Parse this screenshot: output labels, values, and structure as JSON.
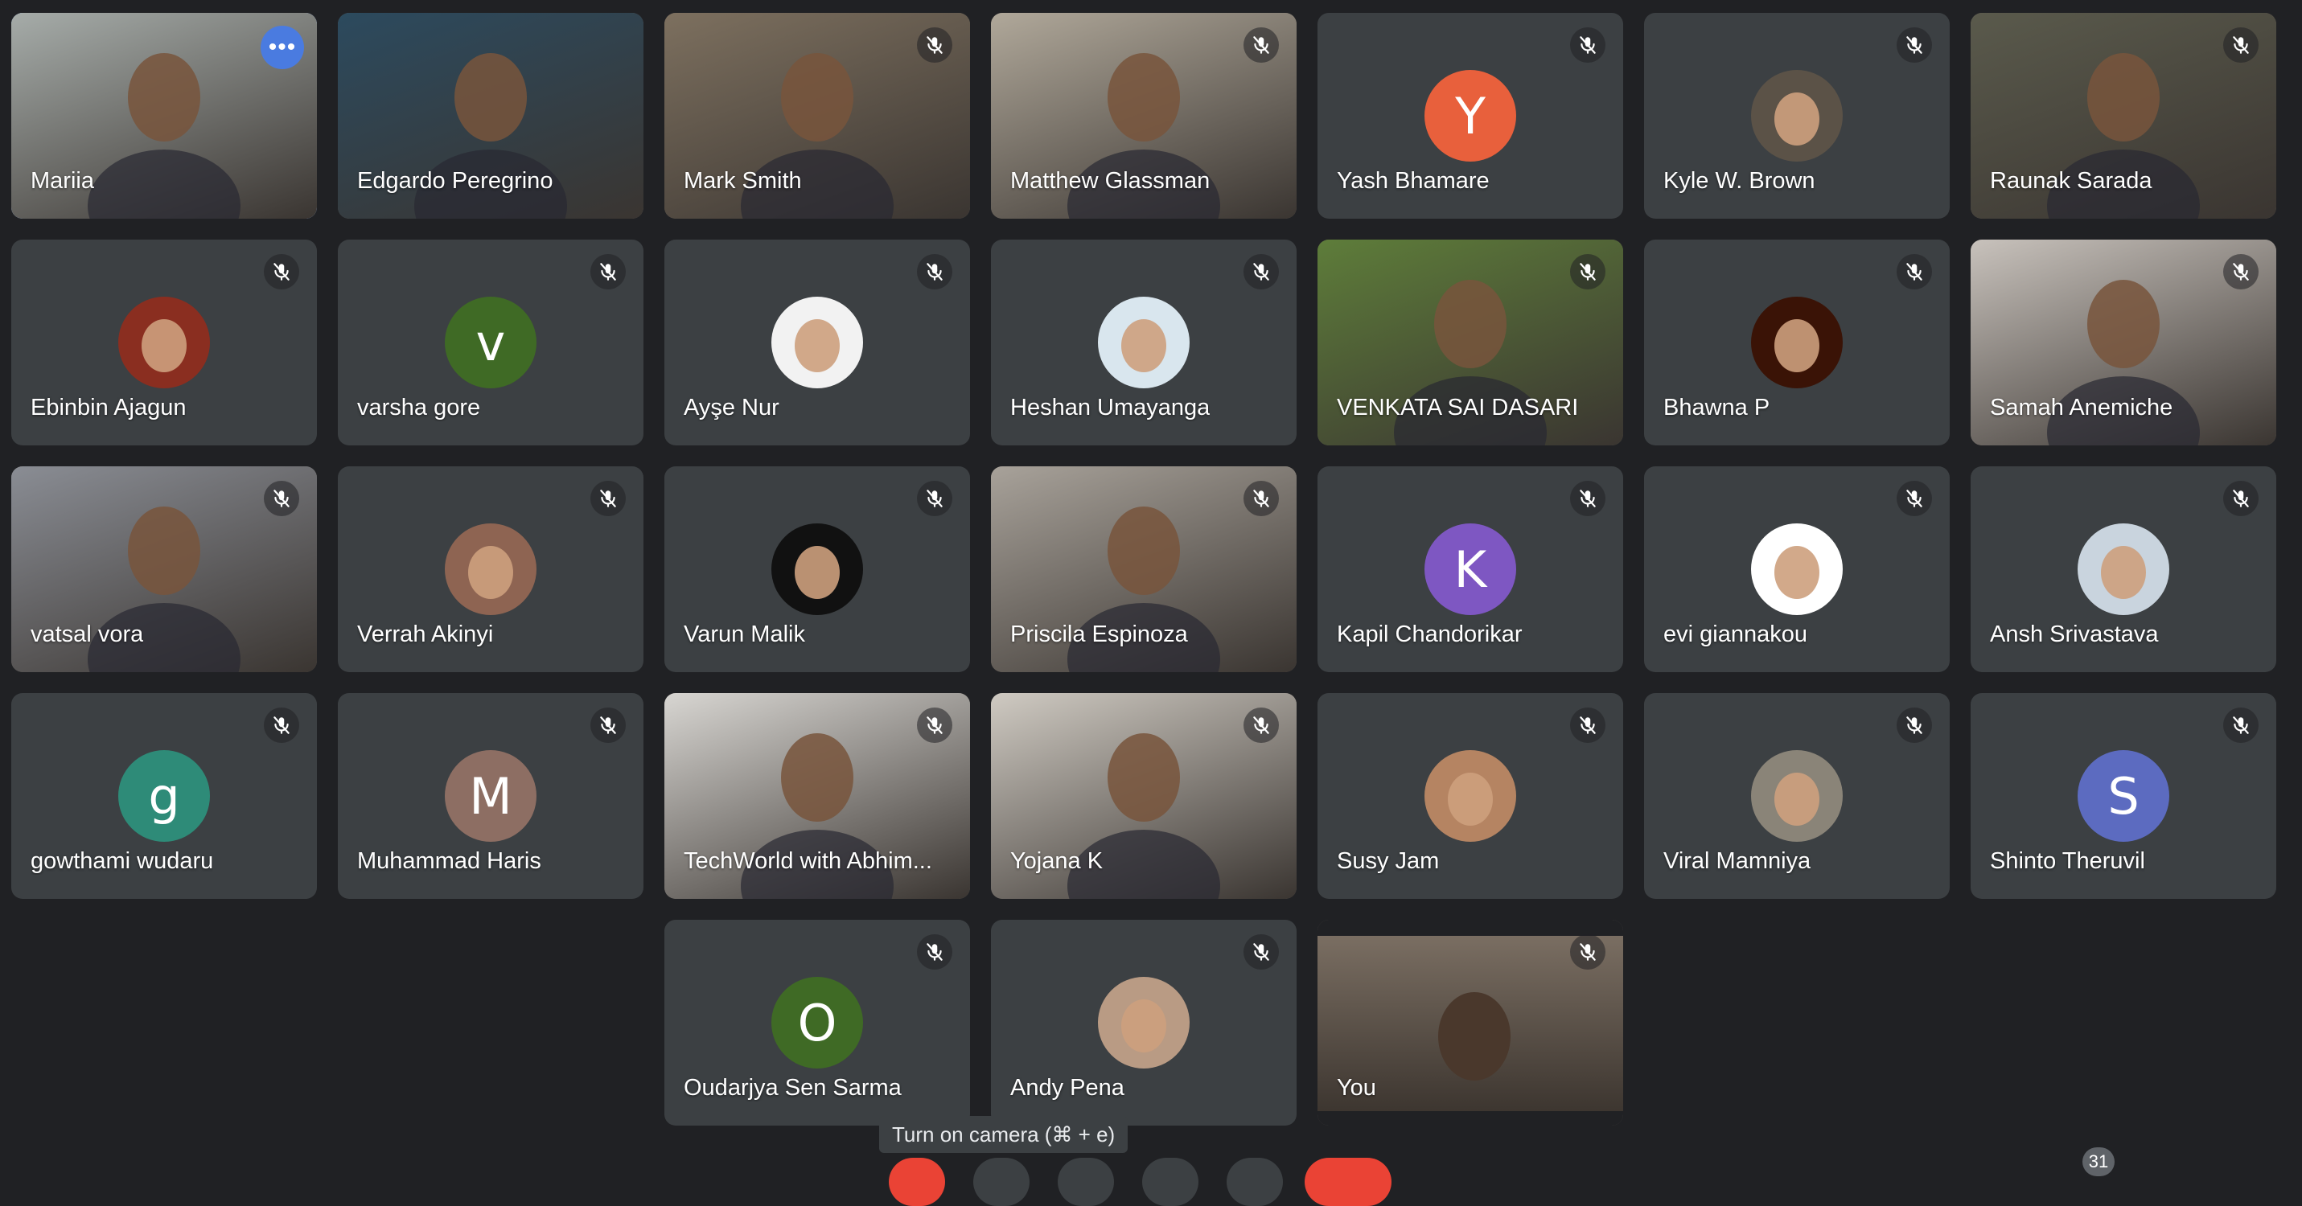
{
  "meeting": {
    "participants_count": "31",
    "tooltip": "Turn on camera (⌘ + e)"
  },
  "colors": {
    "tile": "#3c4043",
    "background": "#202124",
    "active_border": "#8ab4f8"
  },
  "participants": [
    {
      "name": "Mariia",
      "type": "video",
      "bg": "#a6aca9",
      "active": true,
      "more": true,
      "muted": false
    },
    {
      "name": "Edgardo Peregrino",
      "type": "video",
      "bg": "#2c4a5e",
      "muted": false
    },
    {
      "name": "Mark Smith",
      "type": "video",
      "bg": "#7d705f",
      "muted": true
    },
    {
      "name": "Matthew Glassman",
      "type": "video",
      "bg": "#b0a89a",
      "muted": true
    },
    {
      "name": "Yash Bhamare",
      "type": "letter",
      "letter": "Y",
      "color": "#e8603c",
      "muted": true
    },
    {
      "name": "Kyle W. Brown",
      "type": "photo",
      "color": "#5b5247",
      "muted": true
    },
    {
      "name": "Raunak Sarada",
      "type": "video",
      "bg": "#5a5a4c",
      "muted": true
    },
    {
      "name": "Ebinbin Ajagun",
      "type": "photo",
      "color": "#8a2e20",
      "muted": true
    },
    {
      "name": "varsha gore",
      "type": "letter",
      "letter": "v",
      "color": "#3f6a25",
      "muted": true
    },
    {
      "name": "Ayşe Nur",
      "type": "photo",
      "color": "#f2f2f2",
      "muted": true
    },
    {
      "name": "Heshan Umayanga",
      "type": "photo",
      "color": "#d9e6ee",
      "muted": true
    },
    {
      "name": "VENKATA SAI DASARI",
      "type": "video",
      "bg": "#5e7d3a",
      "muted": true
    },
    {
      "name": "Bhawna P",
      "type": "photo",
      "color": "#3a1306",
      "muted": true
    },
    {
      "name": "Samah Anemiche",
      "type": "video",
      "bg": "#c8c2bc",
      "muted": true
    },
    {
      "name": "vatsal vora",
      "type": "video",
      "bg": "#8a8d94",
      "muted": true
    },
    {
      "name": "Verrah Akinyi",
      "type": "photo",
      "color": "#8e6452",
      "muted": true
    },
    {
      "name": "Varun Malik",
      "type": "photo",
      "color": "#111111",
      "muted": true
    },
    {
      "name": "Priscila Espinoza",
      "type": "video",
      "bg": "#a8a29a",
      "muted": true
    },
    {
      "name": "Kapil Chandorikar",
      "type": "letter",
      "letter": "K",
      "color": "#7e57c2",
      "muted": true
    },
    {
      "name": "evi giannakou",
      "type": "photo",
      "color": "#ffffff",
      "muted": true
    },
    {
      "name": "Ansh Srivastava",
      "type": "photo",
      "color": "#c9d4de",
      "muted": true
    },
    {
      "name": "gowthami wudaru",
      "type": "letter",
      "letter": "g",
      "color": "#2e8b78",
      "muted": true
    },
    {
      "name": "Muhammad Haris",
      "type": "letter",
      "letter": "M",
      "color": "#8d6e63",
      "muted": true
    },
    {
      "name": "TechWorld with Abhim...",
      "type": "video",
      "bg": "#d8d6d2",
      "muted": true
    },
    {
      "name": "Yojana K",
      "type": "video",
      "bg": "#cfcac2",
      "muted": true
    },
    {
      "name": "Susy Jam",
      "type": "photo",
      "color": "#b58462",
      "muted": true
    },
    {
      "name": "Viral Mamniya",
      "type": "photo",
      "color": "#8a8478",
      "muted": true
    },
    {
      "name": "Shinto Theruvil",
      "type": "letter",
      "letter": "S",
      "color": "#5c6bc0",
      "muted": true
    },
    {
      "name": "Oudarjya Sen Sarma",
      "type": "letter",
      "letter": "O",
      "color": "#3f6a25",
      "muted": true
    },
    {
      "name": "Andy Pena",
      "type": "photo",
      "color": "#b99b84",
      "muted": true
    },
    {
      "name": "You",
      "type": "video",
      "bg": "#7a6e62",
      "muted": true,
      "self": true
    }
  ]
}
